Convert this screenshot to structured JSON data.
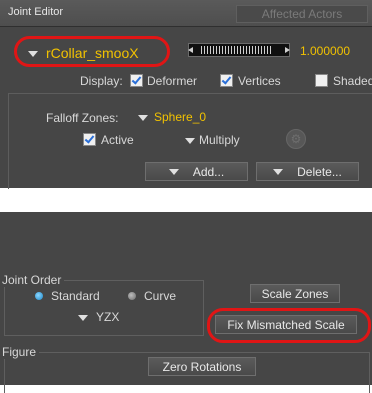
{
  "titlebar": {
    "title": "Joint Editor",
    "affected_tab": "Affected Actors"
  },
  "actor": {
    "name": "rCollar_smooX",
    "value": "1.000000"
  },
  "display": {
    "label": "Display:",
    "deformer": "Deformer",
    "deformer_checked": true,
    "vertices": "Vertices",
    "vertices_checked": true,
    "shaded": "Shaded",
    "shaded_checked": false
  },
  "falloff": {
    "label": "Falloff Zones:",
    "zone": "Sphere_0",
    "active": "Active",
    "active_checked": true,
    "multiply": "Multiply"
  },
  "buttons": {
    "add": "Add...",
    "delete": "Delete..."
  },
  "joint_order": {
    "label": "Joint Order",
    "standard": "Standard",
    "curve": "Curve",
    "order": "YZX",
    "selected": "Standard"
  },
  "actions": {
    "scale_zones": "Scale Zones",
    "fix_mismatched": "Fix Mismatched Scale"
  },
  "figure": {
    "label": "Figure",
    "zero_rotations": "Zero Rotations"
  },
  "colors": {
    "panel": "#464646",
    "accent_text": "#f2c200",
    "highlight_circle": "#e01515",
    "check": "#2a6fd8",
    "radio_on": "#1b87c9"
  }
}
